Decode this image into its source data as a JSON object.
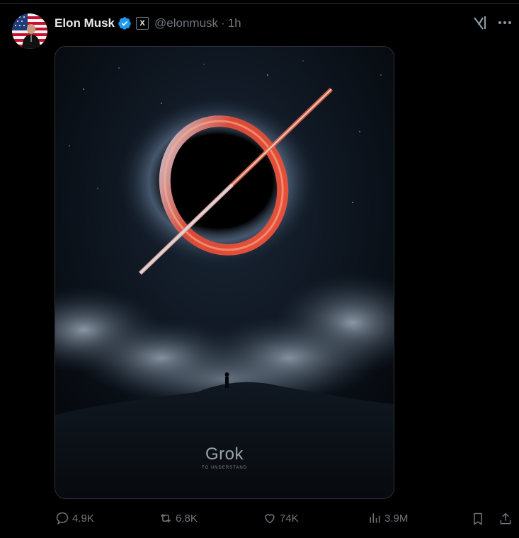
{
  "author": {
    "display_name": "Elon Musk",
    "handle": "@elonmusk",
    "separator": "·",
    "time": "1h",
    "verified_icon": "verified-badge-icon",
    "affiliation_badge": "X"
  },
  "media": {
    "brand_text": "Grok",
    "tagline": "TO UNDERSTAND"
  },
  "actions": {
    "reply_count": "4.9K",
    "repost_count": "6.8K",
    "like_count": "74K",
    "view_count": "3.9M"
  },
  "colors": {
    "background": "#000000",
    "text": "#e7e9ea",
    "muted": "#71767b",
    "verified": "#1d9bf0",
    "border": "#2f3336"
  }
}
